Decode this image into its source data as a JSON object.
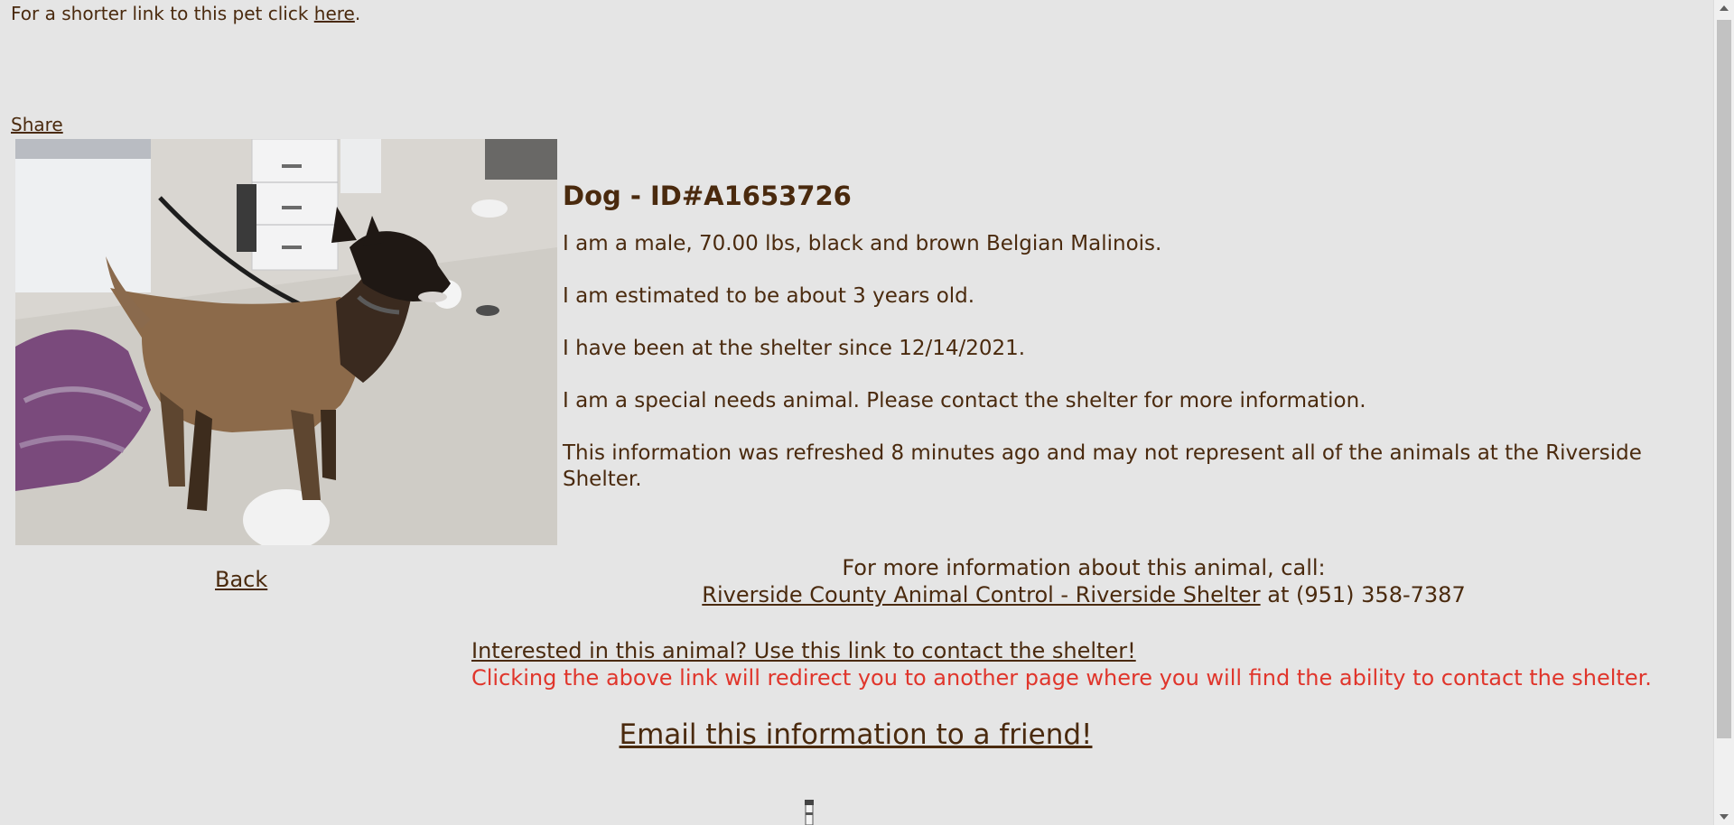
{
  "shortlink": {
    "prefix": "For a shorter link to this pet click ",
    "link_text": "here",
    "suffix": "."
  },
  "share_label": "Share",
  "photo": {
    "icon": "dog-photo",
    "alt": "Dog photo"
  },
  "back_label": "Back",
  "animal": {
    "title": "Dog - ID#A1653726",
    "description": "I am a male, 70.00 lbs, black and brown Belgian Malinois.",
    "age": "I am estimated to be about 3 years old.",
    "shelter_since": "I have been at the shelter since 12/14/2021.",
    "special_needs": "I am a special needs animal. Please contact the shelter for more information.",
    "refresh_note": "This information was refreshed 8 minutes ago and may not represent all of the animals at the Riverside Shelter."
  },
  "call": {
    "line1": "For more information about this animal, call:",
    "shelter_link": "Riverside County Animal Control - Riverside Shelter",
    "phone": " at (951) 358-7387"
  },
  "contact": {
    "link_text": "Interested in this animal? Use this link to contact the shelter!",
    "warning": "Clicking the above link will redirect you to another page where you will find the ability to contact the shelter."
  },
  "email_label": "Email this information to a friend!",
  "colors": {
    "background": "#e5e5e5",
    "text": "#4a2a0e",
    "warning": "#e0352b"
  }
}
